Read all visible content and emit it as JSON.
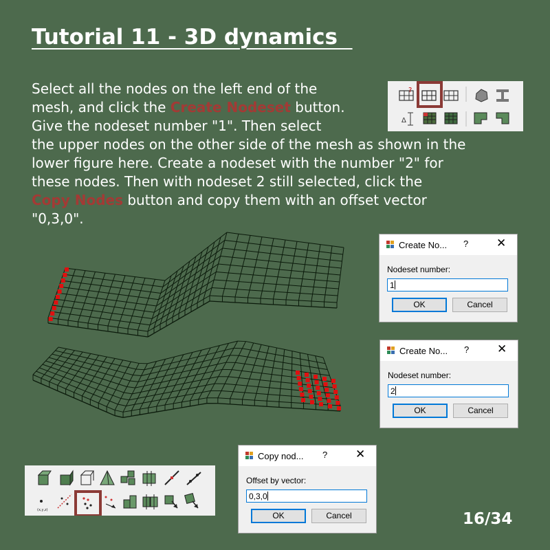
{
  "slide": {
    "title": "Tutorial 11 - 3D dynamics  ",
    "lines": [
      [
        "Select all the nodes on the left end of the"
      ],
      [
        "mesh, and click the ",
        {
          "hl": "Create Nodeset"
        },
        " button."
      ],
      [
        "Give the nodeset number \"1\". Then select"
      ],
      [
        "the upper nodes on the other side of the mesh as shown in the"
      ],
      [
        "lower figure here. Create a nodeset with the number \"2\" for"
      ],
      [
        "these nodes. Then with nodeset 2 still selected, click the"
      ],
      [
        {
          "hl": "Copy Nodes"
        },
        " button and copy them with an offset vector"
      ],
      [
        "\"0,3,0\"."
      ]
    ],
    "page_number": "16/34"
  },
  "dialogs": [
    {
      "title": "Create No...",
      "help": "?",
      "close": "✕",
      "label": "Nodeset number:",
      "value": "1",
      "ok": "OK",
      "cancel": "Cancel"
    },
    {
      "title": "Create No...",
      "help": "?",
      "close": "✕",
      "label": "Nodeset number:",
      "value": "2",
      "ok": "OK",
      "cancel": "Cancel"
    },
    {
      "title": "Copy nod...",
      "help": "?",
      "close": "✕",
      "label": "Offset by vector:",
      "value": "0,3,0",
      "ok": "OK",
      "cancel": "Cancel"
    }
  ],
  "toolbar_top": {
    "icons": [
      "delete-grid-icon",
      "create-nodeset-icon",
      "grid-icon",
      "solid-body-icon",
      "beam-section-icon",
      "dimension-icon",
      "mesh-select-icon",
      "mesh-fill-icon",
      "shape-a-icon",
      "shape-b-icon"
    ],
    "highlighted": "create-nodeset-icon"
  },
  "toolbar_bottom": {
    "icons": [
      "hatched-cube-icon",
      "solid-cube-icon",
      "wire-cube-icon",
      "pyramid-icon",
      "scatter-cubes-icon",
      "frame-icon",
      "diagonal-line-icon",
      "double-arrow-icon",
      "single-node-icon",
      "move-nodes-icon",
      "copy-nodes-icon",
      "scatter-nodes-icon",
      "stack-cubes-icon",
      "split-cubes-icon",
      "arrow-cube-icon",
      "rotate-cube-icon"
    ],
    "highlighted": "copy-nodes-icon",
    "node_label": "(x,y,z)"
  },
  "colors": {
    "background": "#4d6a4d",
    "highlight": "#a33a35",
    "mesh": "#0b1a0b",
    "nodes": "#e01010"
  }
}
